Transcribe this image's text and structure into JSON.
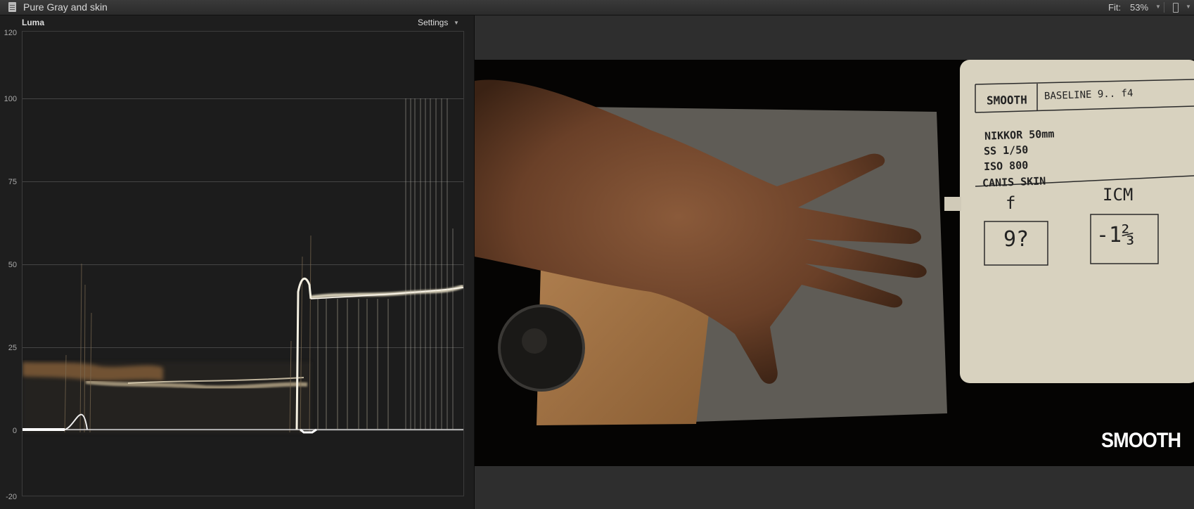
{
  "window": {
    "title": "Pure Gray and skin",
    "fit_label": "Fit:",
    "fit_value": "53%"
  },
  "scope": {
    "type_label": "Luma",
    "settings_label": "Settings",
    "y_axis_ticks": [
      "120",
      "100",
      "75",
      "50",
      "25",
      "0",
      "-20"
    ]
  },
  "viewer": {
    "burned_in_label": "SMOOTH",
    "slate": {
      "style": "SMOOTH",
      "camera": "BASELINE 9.. f4",
      "lens": "NIKKOR 50mm",
      "shutter": "SS 1/50",
      "iso": "ISO 800",
      "subject": "CANIS SKIN",
      "left_head": "f",
      "right_head": "ICM",
      "left_value": "9?",
      "right_value": "-1⅔"
    }
  },
  "icons": [
    "document-icon",
    "chevron-down-icon",
    "video-icon"
  ],
  "colors": {
    "accent_skin": "#c9965a",
    "trace": "#e8e2cf"
  }
}
